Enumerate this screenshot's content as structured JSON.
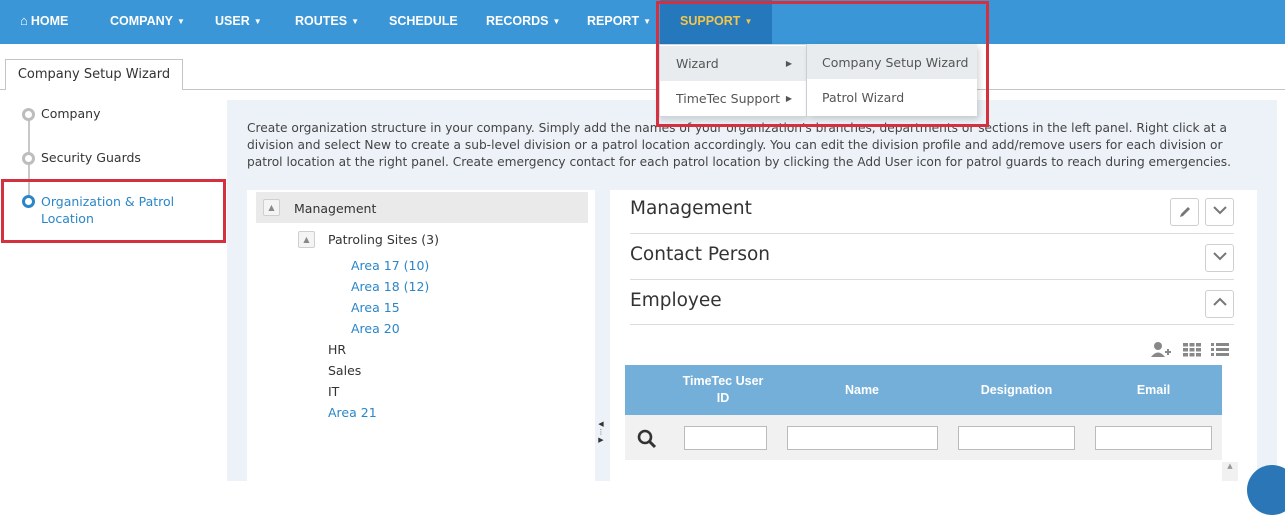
{
  "nav": {
    "home": "HOME",
    "company": "COMPANY",
    "user": "USER",
    "routes": "ROUTES",
    "schedule": "SCHEDULE",
    "records": "RECORDS",
    "report": "REPORT",
    "support": "SUPPORT"
  },
  "support_menu": {
    "items": [
      "Wizard",
      "TimeTec Support"
    ],
    "submenu": [
      "Company Setup Wizard",
      "Patrol Wizard"
    ]
  },
  "tab": {
    "label": "Company Setup Wizard"
  },
  "steps": [
    "Company",
    "Security Guards",
    "Organization & Patrol Location"
  ],
  "description": "Create organization structure in your company. Simply add the names of your organization's branches, departments or sections in the left panel. Right click at a division and select New to create a sub-level division or a patrol location accordingly. You can edit the division profile and add/remove users for each division or patrol location at the right panel. Create emergency contact for each patrol location by clicking the Add User icon for patrol guards to reach during emergencies.",
  "tree": {
    "root": "Management",
    "patroling_sites": "Patroling Sites (3)",
    "areas": [
      "Area 17 (10)",
      "Area 18 (12)",
      "Area 15",
      "Area 20"
    ],
    "others": [
      "HR",
      "Sales",
      "IT"
    ],
    "area21": "Area 21"
  },
  "detail": {
    "sections": [
      "Management",
      "Contact Person",
      "Employee"
    ]
  },
  "grid": {
    "columns": [
      "TimeTec User ID",
      "Name",
      "Designation",
      "Email"
    ]
  },
  "colors": {
    "nav_bg": "#3a96d6",
    "nav_active": "#2578bb",
    "accent": "#2a86c8",
    "highlight": "#d5303e",
    "grid_header": "#73afd9"
  }
}
